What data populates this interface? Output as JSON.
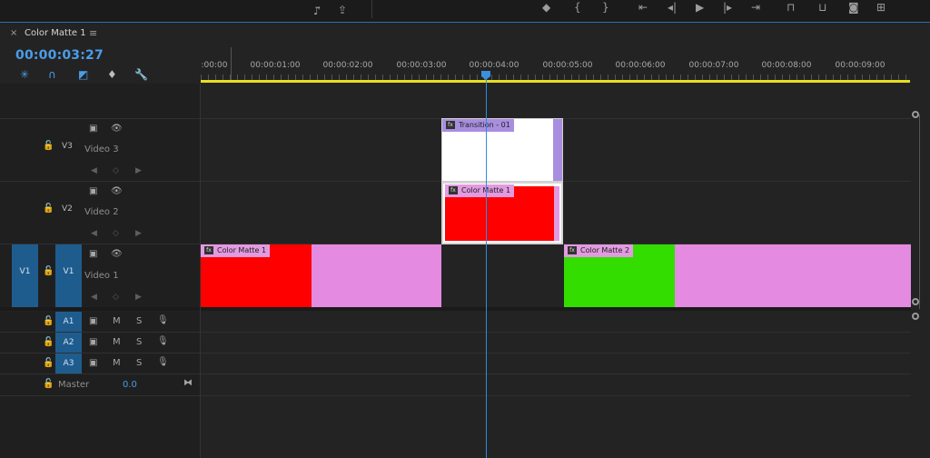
{
  "sequence": {
    "tab_title": "Color Matte 1",
    "close_glyph": "×",
    "menu_glyph": "≡",
    "timecode": "00:00:03:27"
  },
  "ruler": {
    "ticks": [
      ":00:00",
      "00:00:01:00",
      "00:00:02:00",
      "00:00:03:00",
      "00:00:04:00",
      "00:00:05:00",
      "00:00:06:00",
      "00:00:07:00",
      "00:00:08:00",
      "00:00:09:00"
    ]
  },
  "tracks": {
    "v3": {
      "label": "V3",
      "name": "Video 3"
    },
    "v2": {
      "label": "V2",
      "name": "Video 2"
    },
    "v1": {
      "label": "V1",
      "name": "Video 1",
      "source": "V1"
    },
    "a1": {
      "label": "A1",
      "m": "M",
      "s": "S"
    },
    "a2": {
      "label": "A2",
      "m": "M",
      "s": "S"
    },
    "a3": {
      "label": "A3",
      "m": "M",
      "s": "S"
    },
    "master": {
      "name": "Master",
      "value": "0.0"
    }
  },
  "clips": {
    "transition": {
      "title": "Transition - 01"
    },
    "v2_matte": {
      "title": "Color Matte 1"
    },
    "v1_matte1": {
      "title": "Color Matte 1"
    },
    "v1_matte2": {
      "title": "Color Matte 2"
    }
  },
  "colors": {
    "accent": "#4a9de8",
    "clip_label": "#e29ae0",
    "red": "#ff0000",
    "green": "#33dd00",
    "white": "#ffffff",
    "transition_purple": "#a98ee0",
    "playhead": "#2f8be0",
    "work_area": "#e8df20"
  },
  "icons": {
    "lock": "🔓",
    "eye": "👁",
    "film": "▣",
    "mic": "🎙",
    "fx": "fx"
  }
}
